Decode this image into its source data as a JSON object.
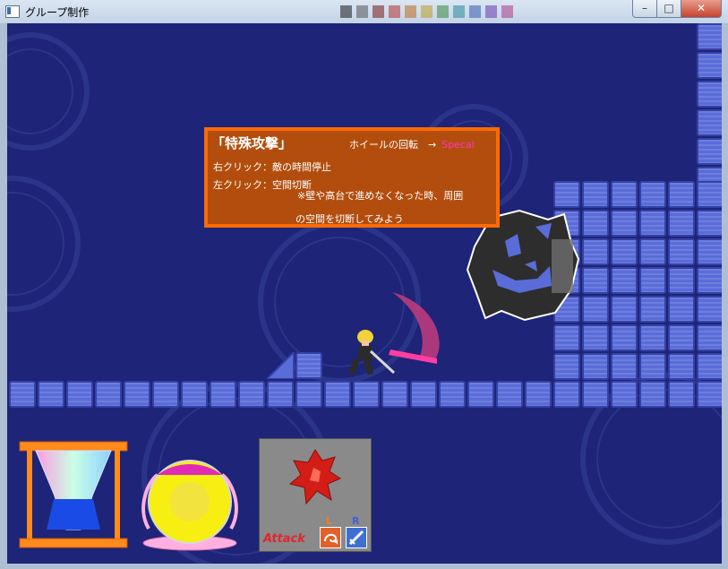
{
  "window": {
    "title": "グループ制作"
  },
  "palette_colors": [
    "#1a1a1a",
    "#555555",
    "#7a1a1a",
    "#b33030",
    "#c06a20",
    "#b9a02a",
    "#3a8a3a",
    "#2a8a9a",
    "#3a5ab0",
    "#6a3ab0",
    "#b03a8a"
  ],
  "tooltip": {
    "title": "「特殊攻撃」",
    "wheel_text": "ホイールの回転　→",
    "special": "Specal",
    "right_click": "右クリック：敵の時間停止",
    "left_click": "左クリック：空間切断",
    "note_line1": "※壁や高台で進めなくなった時、周囲",
    "note_line2": "の空間を切断してみよう"
  },
  "hud": {
    "attack_label": "Attack",
    "key_l": "L",
    "key_r": "R"
  },
  "colors": {
    "sky": "#1e2477",
    "tile": "#5a6cd8",
    "tooltip_bg": "#b34d0d",
    "tooltip_border": "#ff6a00",
    "special": "#ff35c8"
  }
}
